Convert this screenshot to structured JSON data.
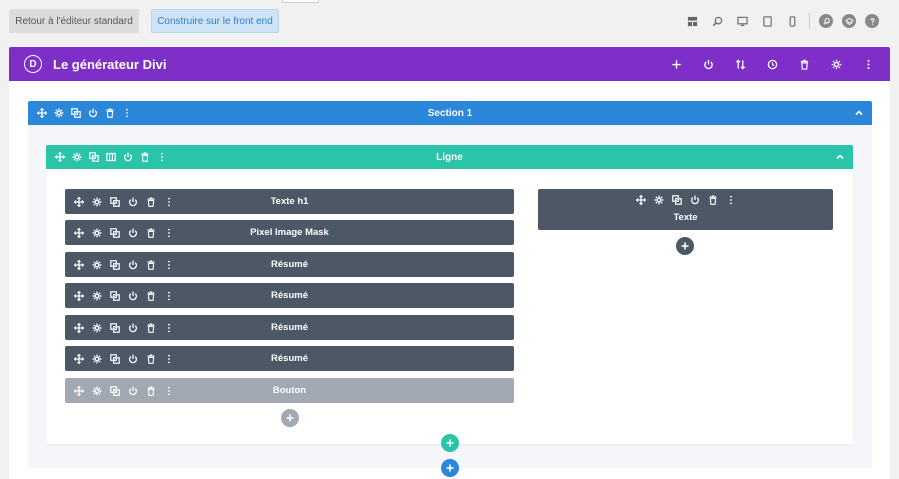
{
  "top_bar": {
    "standard_editor_label": "Retour à l'éditeur standard",
    "front_end_label": "Construire sur le front end",
    "view_icons": [
      "wireframe-icon",
      "zoom-icon",
      "desktop-icon",
      "tablet-icon",
      "phone-icon"
    ],
    "right_icons": [
      "search-icon",
      "layers-icon",
      "help-icon"
    ]
  },
  "builder": {
    "title": "Le générateur Divi",
    "logo_letter": "D",
    "actions": [
      "add-icon",
      "power-icon",
      "sort-icon",
      "history-icon",
      "trash-icon",
      "gear-icon",
      "more-icon"
    ]
  },
  "section": {
    "label": "Section 1",
    "color": "#2b87da"
  },
  "row": {
    "label": "Ligne",
    "color": "#29c4a9"
  },
  "column1": {
    "modules": [
      {
        "label": "Texte h1",
        "disabled": false
      },
      {
        "label": "Pixel Image Mask",
        "disabled": false
      },
      {
        "label": "Résumé",
        "disabled": false
      },
      {
        "label": "Résumé",
        "disabled": false
      },
      {
        "label": "Résumé",
        "disabled": false
      },
      {
        "label": "Résumé",
        "disabled": false
      },
      {
        "label": "Bouton",
        "disabled": true
      }
    ]
  },
  "column2": {
    "modules": [
      {
        "label": "Texte",
        "disabled": false
      }
    ]
  },
  "colors": {
    "builder_purple": "#7e2fc7",
    "module_dark": "#4c5866",
    "module_disabled": "#a2a9b3",
    "add_module": "#4c5866",
    "add_row": "#29c4a9",
    "add_section": "#2b87da"
  }
}
